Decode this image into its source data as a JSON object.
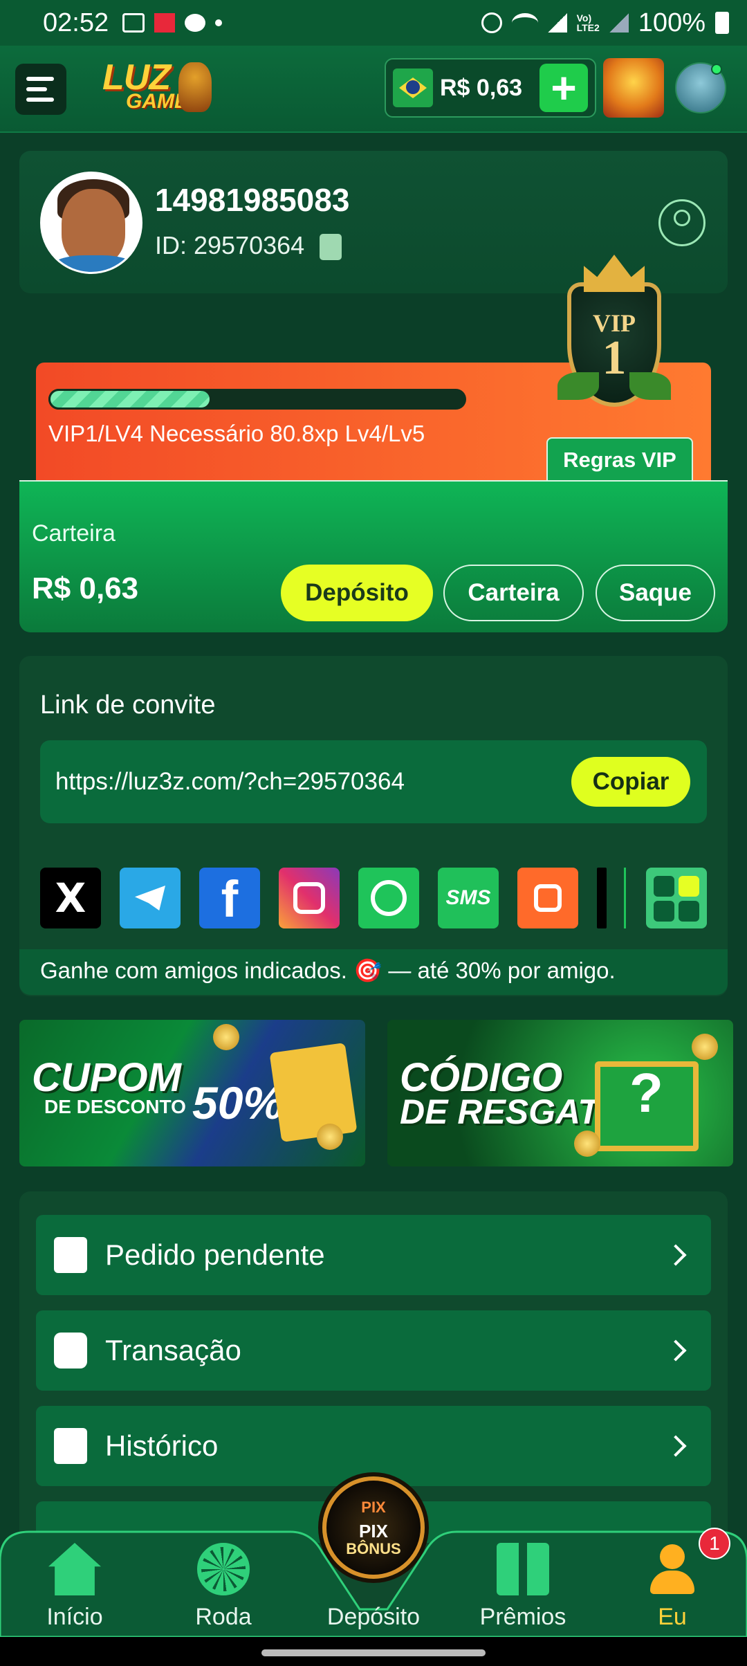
{
  "status_bar": {
    "time": "02:52",
    "battery": "100%"
  },
  "header": {
    "logo_line1": "LUZ",
    "logo_line2": "GAMES",
    "balance": "R$ 0,63",
    "add_symbol": "+"
  },
  "profile": {
    "username": "14981985083",
    "user_id": "ID: 29570364"
  },
  "vip": {
    "progress_fraction": 0.39,
    "requirement_text": "VIP1/LV4 Necessário 80.8xp Lv4/Lv5",
    "badge_title": "VIP",
    "badge_level": "1",
    "rules_button": "Regras VIP"
  },
  "wallet": {
    "label": "Carteira",
    "amount": "R$ 0,63",
    "btn_deposit": "Depósito",
    "btn_wallet": "Carteira",
    "btn_withdraw": "Saque"
  },
  "invite": {
    "title": "Link de convite",
    "link": "https://luz3z.com/?ch=29570364",
    "copy_button": "Copiar",
    "share_targets": [
      "x-icon",
      "telegram-icon",
      "facebook-icon",
      "instagram-icon",
      "whatsapp-icon",
      "sms-icon",
      "kwai-icon",
      "tiktok-icon",
      "more-apps-icon"
    ],
    "share_labels": {
      "x": "X",
      "facebook": "f",
      "sms": "SMS"
    },
    "note": "Ganhe com amigos indicados. 🎯 — até 30% por amigo."
  },
  "banners": {
    "coupon": {
      "line1": "CUPOM",
      "line2": "DE DESCONTO",
      "percent": "50%"
    },
    "redeem": {
      "line1": "CÓDIGO",
      "line2": "DE RESGATE",
      "symbol": "?"
    }
  },
  "menu": [
    {
      "label": "Pedido pendente",
      "icon": "clipboard-coins-icon"
    },
    {
      "label": "Transação",
      "icon": "wallet-icon"
    },
    {
      "label": "Histórico",
      "icon": "history-icon"
    }
  ],
  "bottom_nav": {
    "items": [
      {
        "label": "Início",
        "icon": "home-icon"
      },
      {
        "label": "Roda",
        "icon": "wheel-icon"
      },
      {
        "label": "Depósito",
        "icon": "pix-bonus-icon"
      },
      {
        "label": "Prêmios",
        "icon": "gift-icon"
      },
      {
        "label": "Eu",
        "icon": "user-icon"
      }
    ],
    "pix_top": "PIX",
    "pix_label": "PIX",
    "pix_sub": "BÔNUS",
    "badge_count": "1",
    "active_color": "#ffd23a"
  },
  "colors": {
    "accent_yellow": "#e6ff24",
    "brand_green": "#0fb556",
    "vip_orange": "#f24a26"
  }
}
